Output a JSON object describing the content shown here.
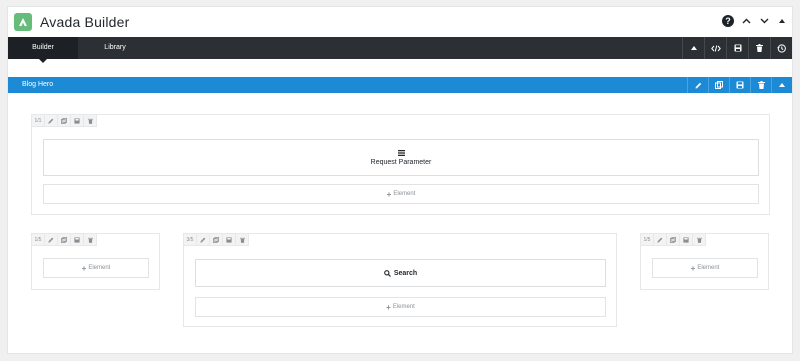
{
  "app": {
    "title": "Avada Builder"
  },
  "window_controls": {
    "help": "?"
  },
  "tabs": [
    {
      "label": "Builder",
      "active": true
    },
    {
      "label": "Library",
      "active": false
    }
  ],
  "tabbar_actions": [
    "caret-up-icon",
    "code-icon",
    "save-icon",
    "trash-icon",
    "history-icon"
  ],
  "container": {
    "title": "Blog Hero",
    "color": "#1d8ad6"
  },
  "row1": {
    "column": {
      "size": "1/1",
      "element": {
        "label": "Request Parameter",
        "icon": "bars-icon"
      },
      "add_label": "Element"
    }
  },
  "row2": {
    "columns": [
      {
        "size": "1/5",
        "add_label": "Element"
      },
      {
        "size": "3/5",
        "element": {
          "label": "Search",
          "icon": "search-icon"
        },
        "add_label": "Element"
      },
      {
        "size": "1/5",
        "add_label": "Element"
      }
    ]
  }
}
